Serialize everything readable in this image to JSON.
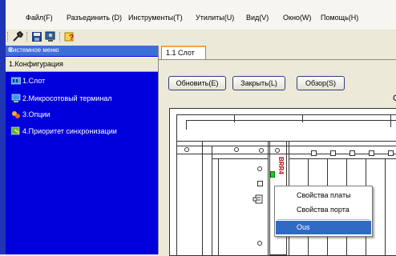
{
  "menubar": {
    "items": [
      "Файл(F)",
      "Разъединить (D)",
      "Инструменты(T)",
      "Утилиты(U)",
      "Вид(V)",
      "Окно(W)",
      "Помощь(H)"
    ]
  },
  "toolbar": {
    "icons": [
      "wrench-icon",
      "floppy-icon",
      "monitor-user-icon",
      "help-icon"
    ]
  },
  "system_menu": {
    "title": "Системное меню",
    "close": "✕",
    "section": "1.Конфигурация",
    "items": [
      {
        "label": "1.Слот",
        "icon": "slot-icon"
      },
      {
        "label": "2.Микросотовый терминал",
        "icon": "terminal-icon"
      },
      {
        "label": "3.Опции",
        "icon": "options-icon"
      },
      {
        "label": "4.Приоритет синхронизации",
        "icon": "sync-priority-icon"
      }
    ]
  },
  "tab": {
    "label": "1.1 Слот"
  },
  "buttons": {
    "refresh": "Обновить(E)",
    "close": "Закрыть(L)",
    "browse": "Обзор(S)"
  },
  "trailing_char": "C",
  "chassis": {
    "slot_label": "BRR4"
  },
  "context_menu": {
    "items": [
      "Свойства платы",
      "Свойства порта",
      "Ous"
    ],
    "selected": "Ous"
  },
  "colors": {
    "panel_blue": "#0000dd",
    "title_blue": "#3d6fd8",
    "selection": "#316ac5",
    "tab_accent": "#f3a83d",
    "slot_label_red": "#c00000",
    "led_green": "#22cc22"
  }
}
